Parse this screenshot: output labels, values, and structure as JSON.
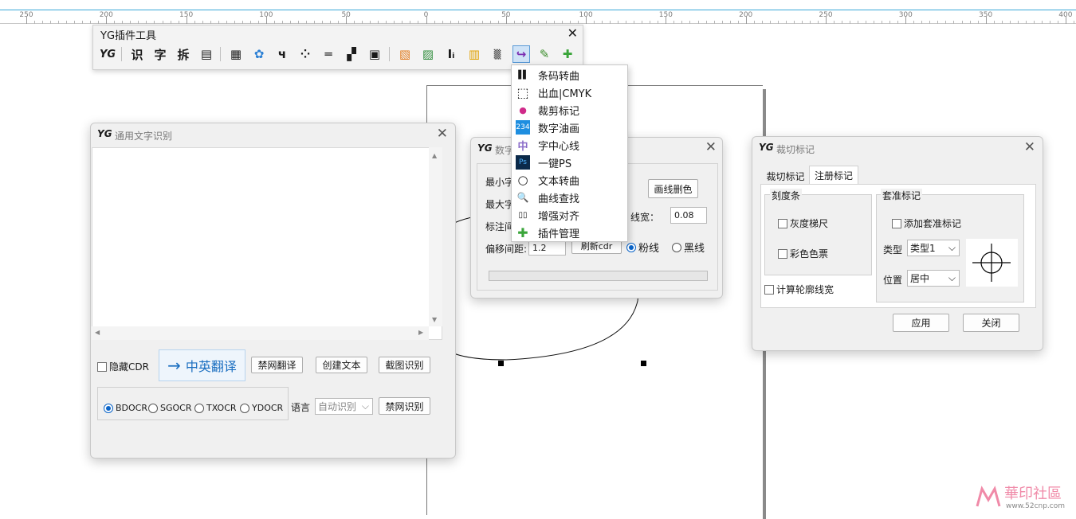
{
  "ruler": {
    "labels": [
      "250",
      "200",
      "150",
      "100",
      "50",
      "0",
      "50",
      "100",
      "150",
      "200",
      "250",
      "300",
      "350",
      "400"
    ]
  },
  "toolbar": {
    "title": "YG插件工具",
    "close": "✕",
    "icons": [
      "YG",
      "识",
      "字",
      "拆",
      "▤",
      "▦",
      "✿",
      "ч",
      "⁘",
      "═",
      "▞",
      "▣",
      "▧",
      "▨",
      "Iᵢ",
      "▥",
      "▒",
      "↪",
      "✎",
      "✚"
    ]
  },
  "menu": {
    "items": [
      {
        "icon": "▌▌",
        "label": "条码转曲"
      },
      {
        "icon": "⬚",
        "label": "出血|CMYK"
      },
      {
        "icon": "●",
        "label": "裁剪标记"
      },
      {
        "icon": "234",
        "label": "数字油画"
      },
      {
        "icon": "中",
        "label": "字中心线"
      },
      {
        "icon": "Ps",
        "label": "一键PS"
      },
      {
        "icon": "○",
        "label": "文本转曲"
      },
      {
        "icon": "🔍",
        "label": "曲线查找"
      },
      {
        "icon": "▯▯",
        "label": "增强对齐"
      },
      {
        "icon": "✚",
        "label": "插件管理"
      }
    ]
  },
  "ocr": {
    "logo": "YG",
    "title": "通用文字识别",
    "hide_cdr": "隐藏CDR",
    "translate": "中英翻译",
    "translate_arrow": "→",
    "no_net_translate": "禁网翻译",
    "create_text": "创建文本",
    "screenshot_ocr": "截图识别",
    "engines": [
      "BDOCR",
      "SGOCR",
      "TXOCR",
      "YDOCR"
    ],
    "lang_label": "语言",
    "lang_value": "自动识别",
    "no_net_ocr": "禁网识别"
  },
  "digit": {
    "logo": "YG",
    "title": "数字",
    "min_label": "最小字",
    "max_label": "最大字",
    "mark_label": "标注间",
    "offset_label": "偏移间距:",
    "offset_value": "1.2",
    "refresh": "刷新cdr",
    "draw_delete": "画线删色",
    "line_width_label": "线宽：",
    "line_width_value": "0.08",
    "pink_line": "粉线",
    "black_line": "黑线"
  },
  "crop": {
    "logo": "YG",
    "title": "裁切标记",
    "tab1": "裁切标记",
    "tab2": "注册标记",
    "scale_group": "刻度条",
    "gray_ruler": "灰度梯尺",
    "color_ticket": "彩色色票",
    "register_group": "套准标记",
    "add_register": "添加套准标记",
    "type_label": "类型",
    "type_value": "类型1",
    "pos_label": "位置",
    "pos_value": "居中",
    "calc_outline": "计算轮廓线宽",
    "apply": "应用",
    "close": "关闭"
  },
  "watermark": {
    "text": "華印社區",
    "url": "www.52cnp.com"
  }
}
